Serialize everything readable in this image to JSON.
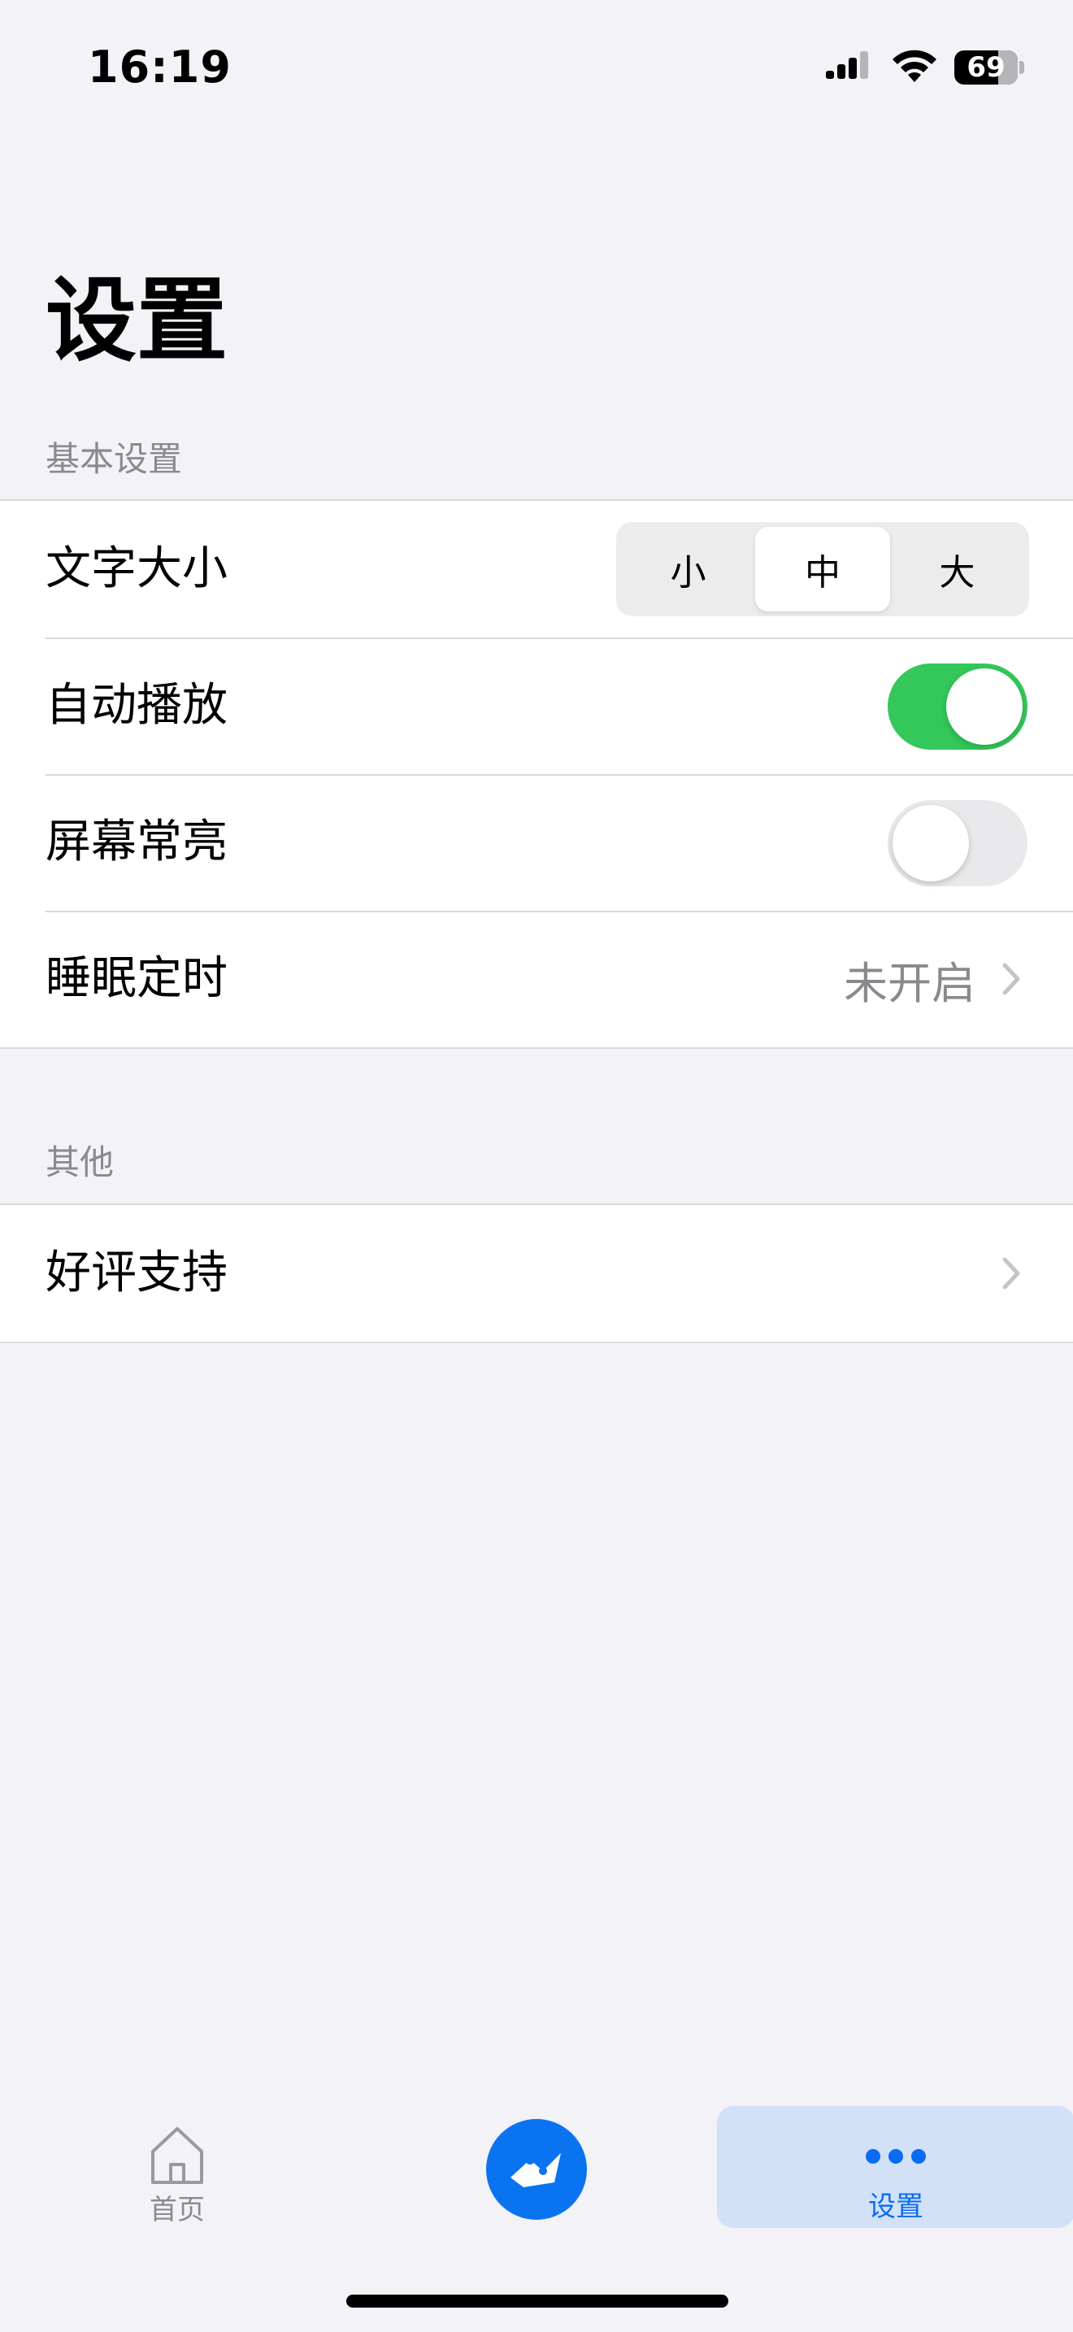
{
  "status_bar": {
    "time": "16:19",
    "battery_level": "69",
    "icons": [
      "signal-icon",
      "wifi-icon",
      "battery-icon"
    ]
  },
  "page": {
    "title": "设置"
  },
  "sections": {
    "basic": {
      "header": "基本设置",
      "font_size": {
        "label": "文字大小",
        "options": [
          "小",
          "中",
          "大"
        ],
        "selected": "中"
      },
      "autoplay": {
        "label": "自动播放",
        "value": true
      },
      "screen_on": {
        "label": "屏幕常亮",
        "value": false
      },
      "sleep_timer": {
        "label": "睡眠定时",
        "value": "未开启"
      }
    },
    "other": {
      "header": "其他",
      "rate": {
        "label": "好评支持"
      }
    }
  },
  "tabbar": {
    "home_label": "首页",
    "settings_label": "设置",
    "active": "settings",
    "colors": {
      "accent": "#0a74f0",
      "toggle_on": "#34c759",
      "active_tab_bg": "#d2e1f8"
    }
  }
}
